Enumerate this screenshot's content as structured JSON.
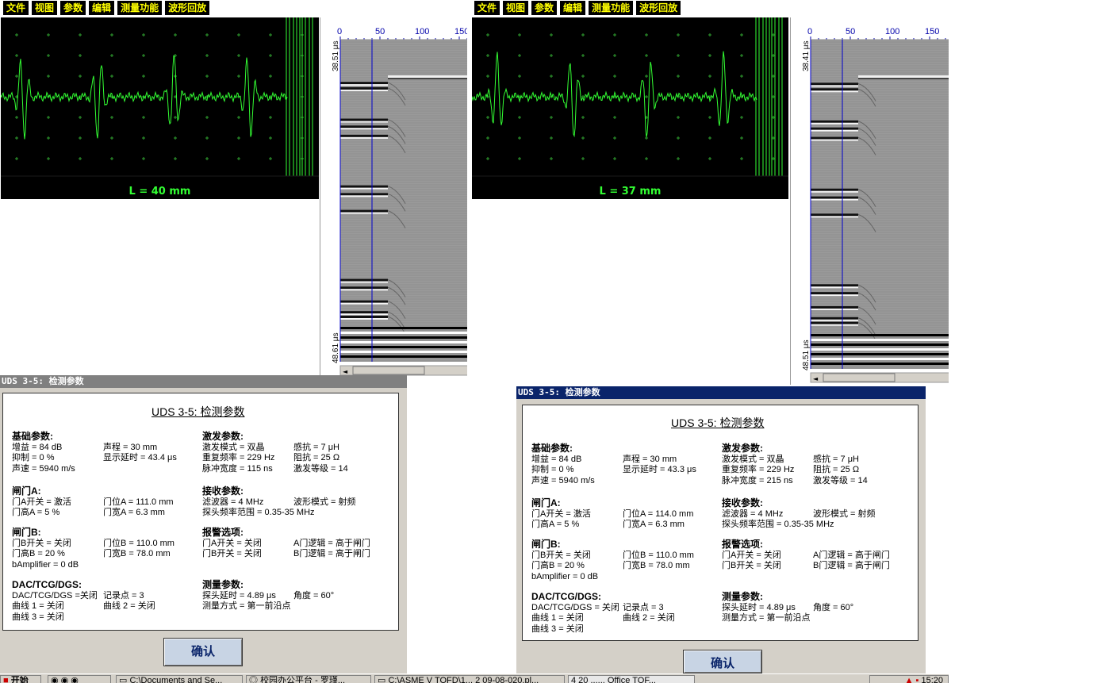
{
  "left": {
    "menu": [
      "文件",
      "视图",
      "参数",
      "编辑",
      "测量功能",
      "波形回放"
    ],
    "scope_label": "L = 40 mm",
    "axis_ticks": [
      "0",
      "50",
      "100",
      "150"
    ],
    "y_top": "38.51 μs",
    "y_bottom": "48.61 μs",
    "dialog": {
      "title": "UDS 3-5: 检测参数",
      "heading": "UDS 3-5: 检测参数",
      "basic": {
        "header": "基础参数:",
        "rows": [
          [
            "增益 = 84 dB",
            "声程 = 30 mm"
          ],
          [
            "抑制 = 0 %",
            "显示延时 = 43.4 μs"
          ],
          [
            "声速 = 5940 m/s",
            ""
          ]
        ]
      },
      "gateA": {
        "header": "闸门A:",
        "rows": [
          [
            "门A开关 = 激活",
            "门位A = 111.0 mm"
          ],
          [
            "门高A = 5 %",
            "门宽A = 6.3 mm"
          ]
        ]
      },
      "gateB": {
        "header": "闸门B:",
        "rows": [
          [
            "门B开关 = 关闭",
            "门位B = 110.0 mm"
          ],
          [
            "门高B = 20 %",
            "门宽B = 78.0 mm"
          ],
          [
            "bAmplifier = 0 dB",
            ""
          ]
        ]
      },
      "dac": {
        "header": "DAC/TCG/DGS:",
        "rows": [
          [
            "DAC/TCG/DGS =关闭",
            "记录点 = 3"
          ],
          [
            "曲线 1 = 关闭",
            "曲线 2 = 关闭"
          ],
          [
            "曲线 3 = 关闭",
            ""
          ]
        ]
      },
      "pulse": {
        "header": "激发参数:",
        "rows": [
          [
            "激发模式 = 双晶",
            "感抗 = 7 μH"
          ],
          [
            "重复频率 = 229 Hz",
            "阻抗 = 25 Ω"
          ],
          [
            "脉冲宽度 = 115 ns",
            "激发等级 = 14"
          ]
        ]
      },
      "receive": {
        "header": "接收参数:",
        "rows": [
          [
            "滤波器 = 4 MHz",
            "波形模式 = 射频"
          ],
          [
            "探头频率范围 = 0.35-35 MHz",
            ""
          ]
        ]
      },
      "alarm": {
        "header": "报警选项:",
        "rows": [
          [
            "门A开关 = 关闭",
            "A门逻辑 = 高于闸门"
          ],
          [
            "门B开关 = 关闭",
            "B门逻辑 = 高于闸门"
          ]
        ]
      },
      "measure": {
        "header": "测量参数:",
        "rows": [
          [
            "探头延时 = 4.89 μs",
            "角度 = 60°"
          ],
          [
            "测量方式 = 第一前沿点",
            ""
          ]
        ]
      },
      "ok": "确认"
    }
  },
  "right": {
    "menu": [
      "文件",
      "视图",
      "参数",
      "编辑",
      "测量功能",
      "波形回放"
    ],
    "scope_label": "L = 37 mm",
    "axis_ticks": [
      "0",
      "50",
      "100",
      "150"
    ],
    "y_top": "38.41 μs",
    "y_bottom": "48.51 μs",
    "dialog": {
      "title": "UDS 3-5: 检测参数",
      "heading": "UDS 3-5: 检测参数",
      "basic": {
        "header": "基础参数:",
        "rows": [
          [
            "增益 = 84 dB",
            "声程 = 30 mm"
          ],
          [
            "抑制 = 0 %",
            "显示延时 = 43.3 μs"
          ],
          [
            "声速 = 5940 m/s",
            ""
          ]
        ]
      },
      "gateA": {
        "header": "闸门A:",
        "rows": [
          [
            "门A开关 = 激活",
            "门位A = 114.0 mm"
          ],
          [
            "门高A = 5 %",
            "门宽A = 6.3 mm"
          ]
        ]
      },
      "gateB": {
        "header": "闸门B:",
        "rows": [
          [
            "门B开关 = 关闭",
            "门位B = 110.0 mm"
          ],
          [
            "门高B = 20 %",
            "门宽B = 78.0 mm"
          ],
          [
            "bAmplifier = 0 dB",
            ""
          ]
        ]
      },
      "dac": {
        "header": "DAC/TCG/DGS:",
        "rows": [
          [
            "DAC/TCG/DGS = 关闭",
            "记录点 = 3"
          ],
          [
            "曲线 1 = 关闭",
            "曲线 2 = 关闭"
          ],
          [
            "曲线 3 = 关闭",
            ""
          ]
        ]
      },
      "pulse": {
        "header": "激发参数:",
        "rows": [
          [
            "激发模式 = 双晶",
            "感抗 = 7 μH"
          ],
          [
            "重复频率 = 229 Hz",
            "阻抗 = 25 Ω"
          ],
          [
            "脉冲宽度 = 215 ns",
            "激发等级 = 14"
          ]
        ]
      },
      "receive": {
        "header": "接收参数:",
        "rows": [
          [
            "滤波器 = 4 MHz",
            "波形模式 = 射频"
          ],
          [
            "探头频率范围 = 0.35-35 MHz",
            ""
          ]
        ]
      },
      "alarm": {
        "header": "报警选项:",
        "rows": [
          [
            "门A开关 = 关闭",
            "A门逻辑 = 高于闸门"
          ],
          [
            "门B开关 = 关闭",
            "B门逻辑 = 高于闸门"
          ]
        ]
      },
      "measure": {
        "header": "测量参数:",
        "rows": [
          [
            "探头延时 = 4.89 μs",
            "角度 = 60°"
          ],
          [
            "测量方式 = 第一前沿点",
            ""
          ]
        ]
      },
      "ok": "确认"
    }
  },
  "taskbar": {
    "start": "开始",
    "items": [
      "C:\\Documents and Se...",
      "校园办公平台 - 罗瑾...",
      "C:\\ASME V TOFD\\1...",
      "2 09-08-020.pl...",
      "4 20 ...... Office TOF..."
    ],
    "clock": "15:20"
  },
  "colors": {
    "signal": "#33ff33",
    "menu_text": "#ffff00",
    "cursor": "#0000cc"
  }
}
